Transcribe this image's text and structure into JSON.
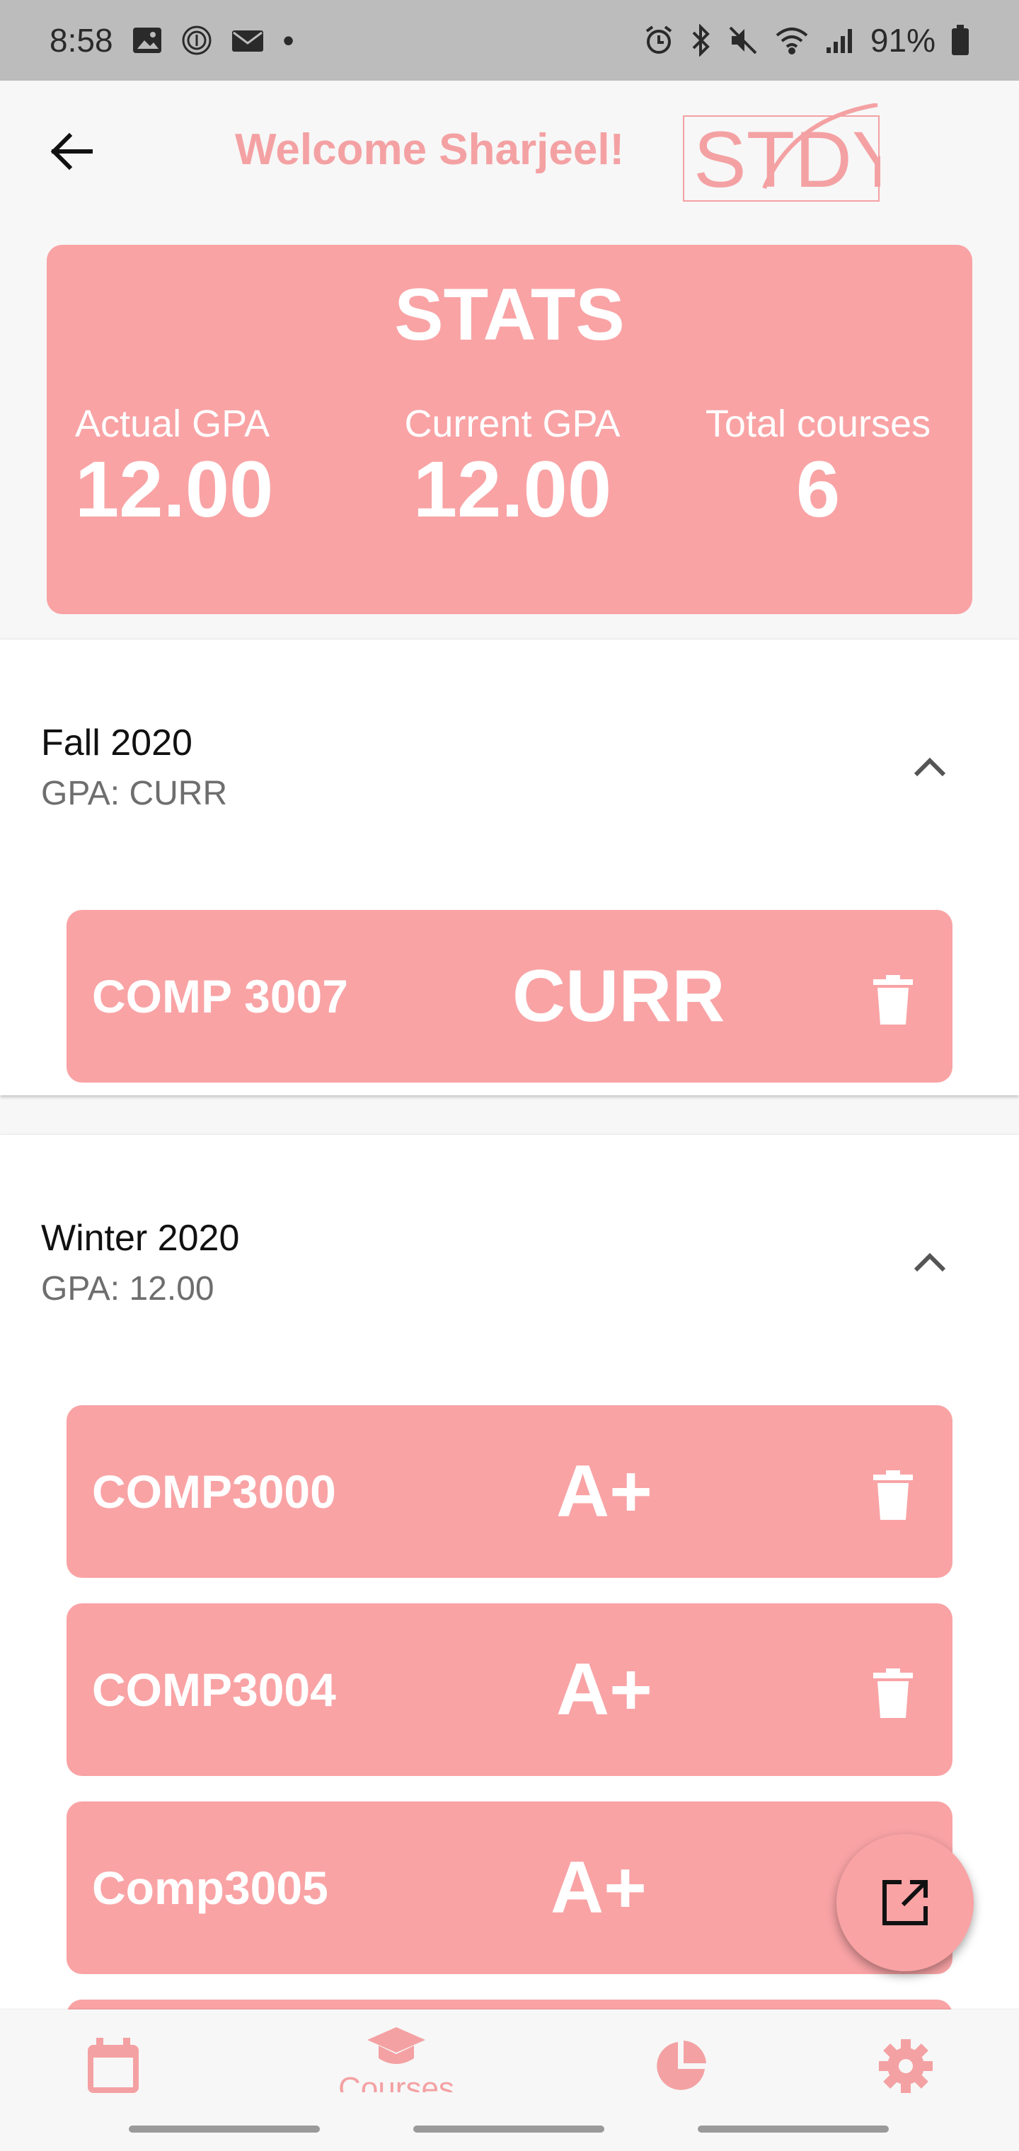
{
  "status_bar": {
    "time": "8:58",
    "dot": "•",
    "battery": "91%"
  },
  "header": {
    "welcome": "Welcome Sharjeel!",
    "logo_text": "STDY"
  },
  "stats": {
    "title": "STATS",
    "items": [
      {
        "label": "Actual GPA",
        "value": "12.00"
      },
      {
        "label": "Current GPA",
        "value": "12.00"
      },
      {
        "label": "Total courses",
        "value": "6"
      }
    ]
  },
  "terms": [
    {
      "title": "Fall 2020",
      "gpa": "GPA: CURR",
      "courses": [
        {
          "name": "COMP 3007",
          "grade": "CURR"
        }
      ]
    },
    {
      "title": "Winter 2020",
      "gpa": "GPA: 12.00",
      "courses": [
        {
          "name": "COMP3000",
          "grade": "A+"
        },
        {
          "name": "COMP3004",
          "grade": "A+"
        },
        {
          "name": "Comp3005",
          "grade": "A+"
        }
      ]
    }
  ],
  "bottom_nav": {
    "courses_label": "Courses"
  },
  "colors": {
    "accent": "#f9a3a5",
    "accent_text": "#f4a1a3",
    "status_bar": "#bcbcbc"
  },
  "icons": [
    "back-arrow-icon",
    "trash-icon",
    "chevron-up-icon",
    "open-external-icon",
    "calendar-icon",
    "graduation-cap-icon",
    "pie-chart-icon",
    "gear-icon"
  ]
}
